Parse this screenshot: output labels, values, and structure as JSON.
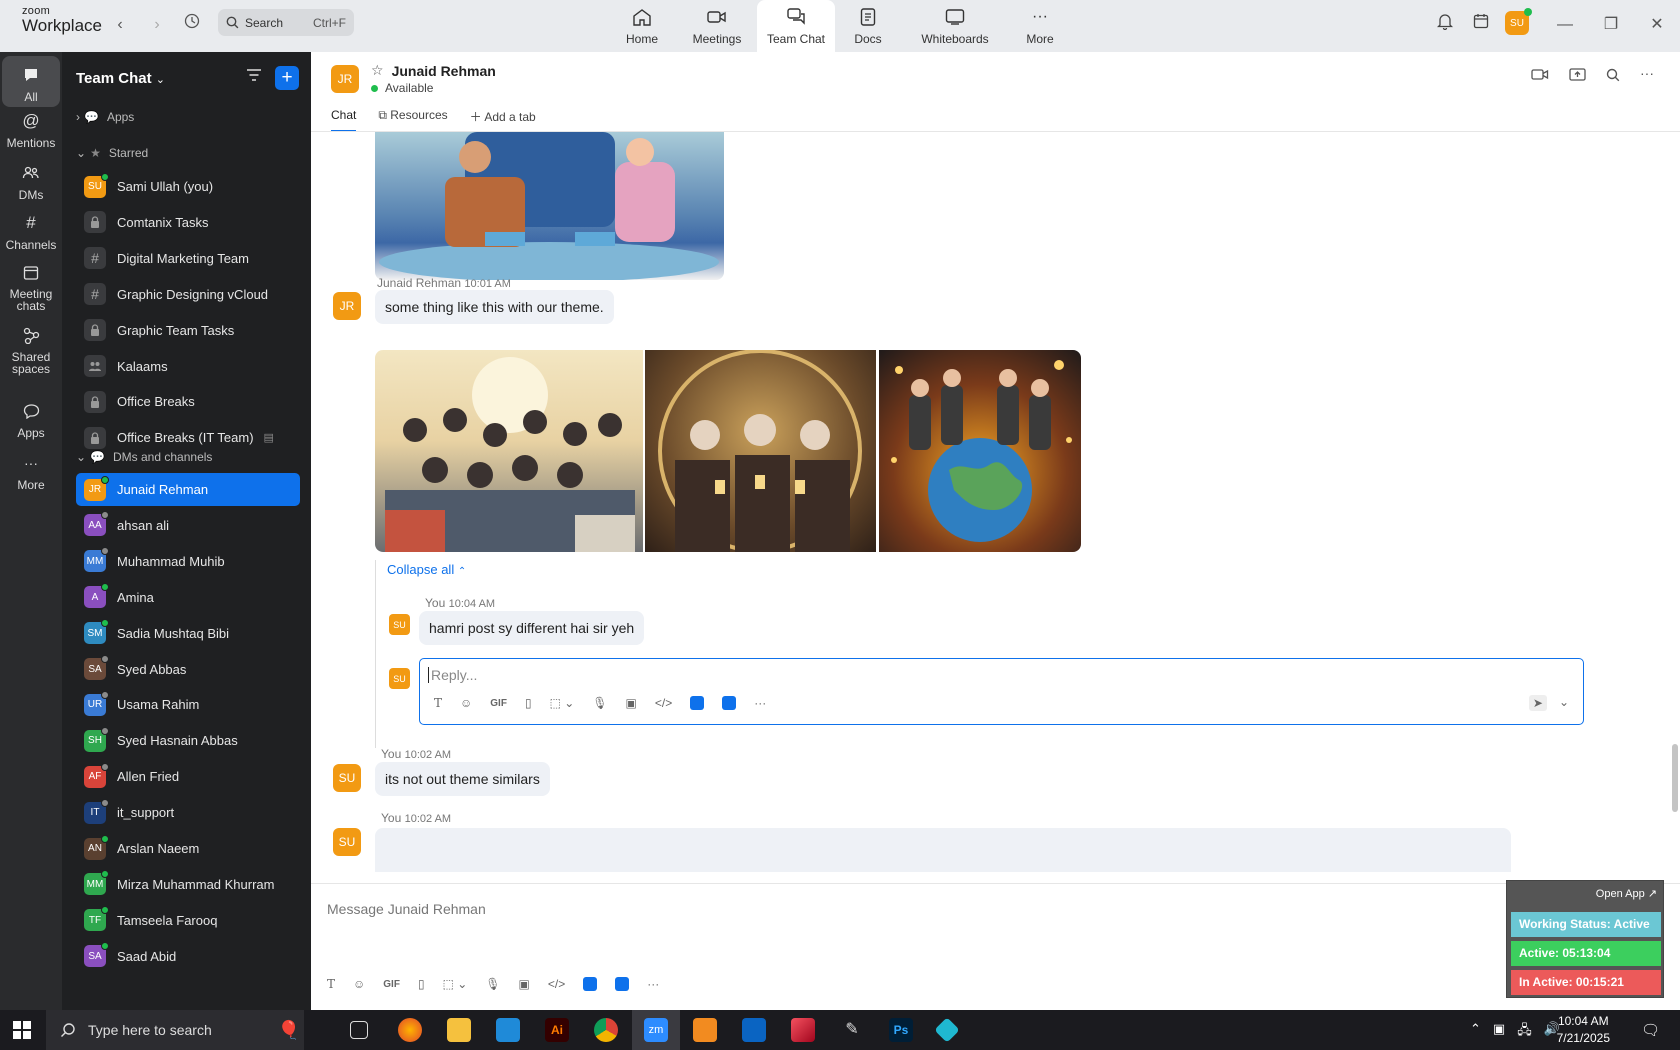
{
  "app": {
    "logo_top": "zoom",
    "logo_bottom": "Workplace"
  },
  "search": {
    "placeholder": "Search",
    "shortcut": "Ctrl+F"
  },
  "nav_tabs": [
    {
      "label": "Home",
      "icon": "home-icon"
    },
    {
      "label": "Meetings",
      "icon": "video-icon"
    },
    {
      "label": "Team Chat",
      "icon": "chat-icon"
    },
    {
      "label": "Docs",
      "icon": "doc-icon"
    },
    {
      "label": "Whiteboards",
      "icon": "whiteboard-icon"
    },
    {
      "label": "More",
      "icon": "more-icon"
    }
  ],
  "user_avatar": "SU",
  "left_sidebar": [
    {
      "label": "All"
    },
    {
      "label": "Mentions"
    },
    {
      "label": "DMs"
    },
    {
      "label": "Channels"
    },
    {
      "label": "Meeting chats"
    },
    {
      "label": "Shared spaces"
    },
    {
      "label": "Apps"
    },
    {
      "label": "More"
    }
  ],
  "panel": {
    "title": "Team Chat",
    "sections": {
      "apps": "Apps",
      "starred": "Starred",
      "dms": "DMs and channels"
    },
    "starred": [
      {
        "label": "Sami Ullah (you)",
        "initials": "SU",
        "color": "#f29a13",
        "status": "online"
      },
      {
        "label": "Comtanix Tasks",
        "kind": "lock"
      },
      {
        "label": "Digital Marketing Team",
        "kind": "hash"
      },
      {
        "label": "Graphic Designing vCloud",
        "kind": "hash"
      },
      {
        "label": "Graphic Team Tasks",
        "kind": "lock"
      },
      {
        "label": "Kalaams",
        "kind": "group"
      },
      {
        "label": "Office Breaks",
        "kind": "lock"
      },
      {
        "label": "Office Breaks (IT Team)",
        "kind": "lock"
      }
    ],
    "dms": [
      {
        "label": "Junaid Rehman",
        "initials": "JR",
        "color": "#f29a13",
        "status": "online"
      },
      {
        "label": "ahsan ali",
        "initials": "AA",
        "color": "#8a4fbf",
        "status": "away"
      },
      {
        "label": "Muhammad Muhib",
        "initials": "MM",
        "color": "#3a7bd5",
        "status": "away"
      },
      {
        "label": "Amina",
        "initials": "A",
        "color": "#8a4fbf",
        "status": "online"
      },
      {
        "label": "Sadia Mushtaq Bibi",
        "initials": "SM",
        "color": "#2e8bc0",
        "status": "online"
      },
      {
        "label": "Syed Abbas",
        "initials": "SA",
        "color": "#6b4a3a",
        "status": "away"
      },
      {
        "label": "Usama Rahim",
        "initials": "UR",
        "color": "#3a7bd5",
        "status": "away"
      },
      {
        "label": "Syed Hasnain Abbas",
        "initials": "SH",
        "color": "#2fa84f",
        "status": "away"
      },
      {
        "label": "Allen Fried",
        "initials": "AF",
        "color": "#d9443a",
        "status": "away"
      },
      {
        "label": "it_support",
        "initials": "IT",
        "color": "#1d3f7a",
        "status": "away"
      },
      {
        "label": "Arslan Naeem",
        "initials": "AN",
        "color": "#5a4030",
        "status": "online"
      },
      {
        "label": "Mirza Muhammad Khurram",
        "initials": "MM",
        "color": "#2fa84f",
        "status": "online"
      },
      {
        "label": "Tamseela Farooq",
        "initials": "TF",
        "color": "#2fa84f",
        "status": "online"
      },
      {
        "label": "Saad Abid",
        "initials": "SA",
        "color": "#8a4fbf",
        "status": "online"
      }
    ]
  },
  "chat": {
    "contact": "Junaid Rehman",
    "contact_initials": "JR",
    "status": "Available",
    "tabs": [
      "Chat",
      "Resources",
      "Add a tab"
    ],
    "msg1": {
      "author": "Junaid Rehman",
      "time": "10:01 AM",
      "text": "some thing like this with our theme."
    },
    "collapse": "Collapse all",
    "thread_reply": {
      "author": "You",
      "time": "10:04 AM",
      "text": "hamri post sy different hai sir yeh",
      "initials": "SU"
    },
    "reply_placeholder": "Reply...",
    "msg2": {
      "author": "You",
      "time": "10:02 AM",
      "text": "its not out theme similars",
      "initials": "SU"
    },
    "msg3": {
      "author": "You",
      "time": "10:02 AM",
      "initials": "SU"
    },
    "composer_placeholder": "Message Junaid Rehman"
  },
  "status_widget": {
    "open_app": "Open App ↗",
    "working": "Working Status: Active",
    "active": "Active: 05:13:04",
    "inactive": "In Active: 00:15:21"
  },
  "taskbar": {
    "search_placeholder": "Type here to search",
    "time": "10:04 AM",
    "date": "7/21/2025"
  }
}
